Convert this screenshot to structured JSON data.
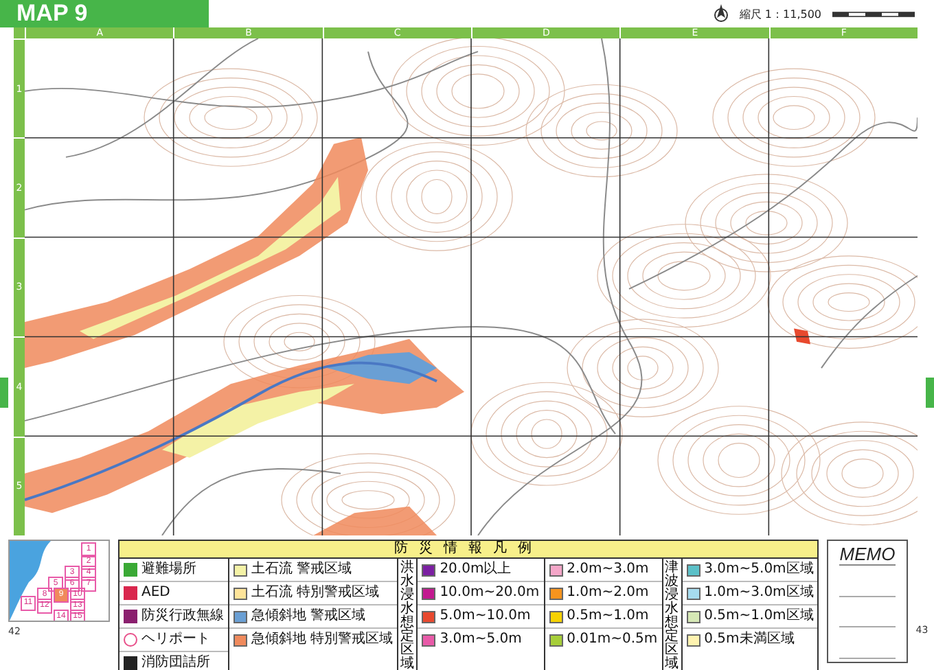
{
  "header": {
    "title": "MAP 9",
    "scale": "縮尺 1：11,500"
  },
  "map": {
    "columns": [
      "A",
      "B",
      "C",
      "D",
      "E",
      "F"
    ],
    "rows": [
      "1",
      "2",
      "3",
      "4",
      "5"
    ]
  },
  "locator": {
    "cells": [
      {
        "label": "1",
        "selected": false
      },
      {
        "label": "2",
        "selected": false
      },
      {
        "label": "3",
        "selected": false
      },
      {
        "label": "4",
        "selected": false
      },
      {
        "label": "5",
        "selected": false
      },
      {
        "label": "6",
        "selected": false
      },
      {
        "label": "7",
        "selected": false
      },
      {
        "label": "8",
        "selected": false
      },
      {
        "label": "9",
        "selected": true
      },
      {
        "label": "10",
        "selected": false
      },
      {
        "label": "11",
        "selected": false
      },
      {
        "label": "12",
        "selected": false
      },
      {
        "label": "13",
        "selected": false
      },
      {
        "label": "14",
        "selected": false
      },
      {
        "label": "15",
        "selected": false
      }
    ]
  },
  "legend": {
    "title": "防災情報凡例",
    "symbols": [
      {
        "label": "避難場所",
        "color": "#3aa935",
        "kind": "square"
      },
      {
        "label": "AED",
        "color": "#d9264d",
        "kind": "square"
      },
      {
        "label": "防災行政無線",
        "color": "#8b1f6e",
        "kind": "square"
      },
      {
        "label": "ヘリポート",
        "color": "#e8508a",
        "kind": "ring"
      },
      {
        "label": "消防団詰所",
        "color": "#222222",
        "kind": "square"
      }
    ],
    "hazards": [
      {
        "label": "土石流 警戒区域",
        "color": "#f4f2a6"
      },
      {
        "label": "土石流 特別警戒区域",
        "color": "#fde49a"
      },
      {
        "label": "急傾斜地 警戒区域",
        "color": "#6a9fd4"
      },
      {
        "label": "急傾斜地 特別警戒区域",
        "color": "#f08a5c"
      }
    ],
    "flood": {
      "label": "洪水浸水想定区域",
      "items": [
        {
          "label": "20.0m以上",
          "color": "#7b1fa2"
        },
        {
          "label": "10.0m~20.0m",
          "color": "#c2188f"
        },
        {
          "label": "5.0m~10.0m",
          "color": "#e8492e"
        },
        {
          "label": "3.0m~5.0m",
          "color": "#e85aa8"
        },
        {
          "label": "2.0m~3.0m",
          "color": "#f4a6c8"
        },
        {
          "label": "1.0m~2.0m",
          "color": "#f7941d"
        },
        {
          "label": "0.5m~1.0m",
          "color": "#f6d200"
        },
        {
          "label": "0.01m~0.5m",
          "color": "#a6ce39"
        }
      ]
    },
    "tsunami": {
      "label": "津波浸水想定区域",
      "items": [
        {
          "label": "3.0m~5.0m区域",
          "color": "#5bc0c8"
        },
        {
          "label": "1.0m~3.0m区域",
          "color": "#a6dcef"
        },
        {
          "label": "0.5m~1.0m区域",
          "color": "#d6e8b5"
        },
        {
          "label": "0.5m未満区域",
          "color": "#fff3b0"
        }
      ]
    }
  },
  "memo": {
    "title": "MEMO"
  },
  "pages": [
    "42",
    "43"
  ]
}
